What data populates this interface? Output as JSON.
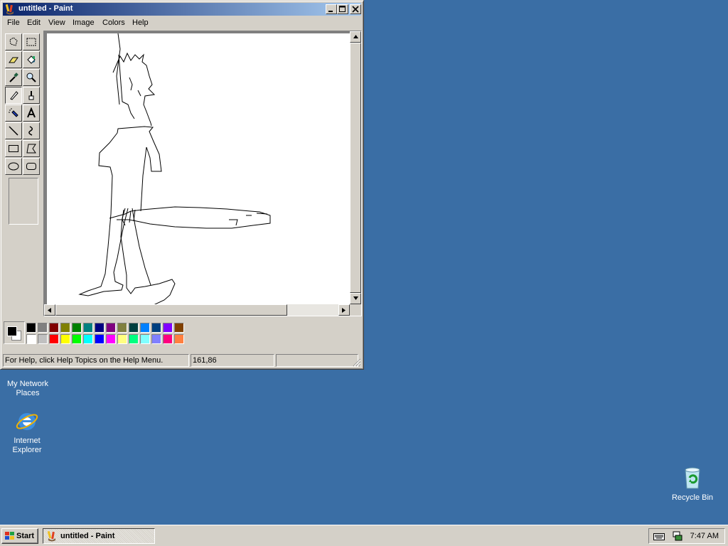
{
  "window": {
    "title": "untitled - Paint",
    "menu": [
      "File",
      "Edit",
      "View",
      "Image",
      "Colors",
      "Help"
    ]
  },
  "tools": [
    {
      "name": "free-form-select",
      "icon": "free-select-icon"
    },
    {
      "name": "select",
      "icon": "select-icon"
    },
    {
      "name": "eraser",
      "icon": "eraser-icon"
    },
    {
      "name": "fill-with-color",
      "icon": "fill-bucket-icon"
    },
    {
      "name": "pick-color",
      "icon": "eyedropper-icon"
    },
    {
      "name": "magnifier",
      "icon": "magnifier-icon"
    },
    {
      "name": "pencil",
      "icon": "pencil-icon",
      "active": true
    },
    {
      "name": "brush",
      "icon": "brush-icon"
    },
    {
      "name": "airbrush",
      "icon": "airbrush-icon"
    },
    {
      "name": "text",
      "icon": "text-icon"
    },
    {
      "name": "line",
      "icon": "line-icon"
    },
    {
      "name": "curve",
      "icon": "curve-icon"
    },
    {
      "name": "rectangle",
      "icon": "rectangle-icon"
    },
    {
      "name": "polygon",
      "icon": "polygon-icon"
    },
    {
      "name": "ellipse",
      "icon": "ellipse-icon"
    },
    {
      "name": "rounded-rectangle",
      "icon": "rounded-rectangle-icon"
    }
  ],
  "palette": {
    "foreground": "#000000",
    "background": "#ffffff",
    "row1": [
      "#000000",
      "#808080",
      "#800000",
      "#808000",
      "#008000",
      "#008080",
      "#000080",
      "#800080",
      "#808040",
      "#004040",
      "#0080ff",
      "#004080",
      "#8000ff",
      "#804000"
    ],
    "row2": [
      "#ffffff",
      "#c0c0c0",
      "#ff0000",
      "#ffff00",
      "#00ff00",
      "#00ffff",
      "#0000ff",
      "#ff00ff",
      "#ffff80",
      "#00ff80",
      "#80ffff",
      "#8080ff",
      "#ff0080",
      "#ff8040"
    ]
  },
  "status": {
    "help_text": "For Help, click Help Topics on the Help Menu.",
    "coordinates": "161,86",
    "size": ""
  },
  "desktop": {
    "icons": [
      {
        "label": "My Network Places",
        "icon": "network-places-icon"
      },
      {
        "label": "Internet Explorer",
        "icon": "internet-explorer-icon"
      },
      {
        "label": "Recycle Bin",
        "icon": "recycle-bin-icon"
      }
    ]
  },
  "taskbar": {
    "start_label": "Start",
    "task_label": "untitled - Paint",
    "clock": "7:47 AM",
    "tray_icons": [
      "keyboard-icon",
      "network-icon"
    ]
  }
}
